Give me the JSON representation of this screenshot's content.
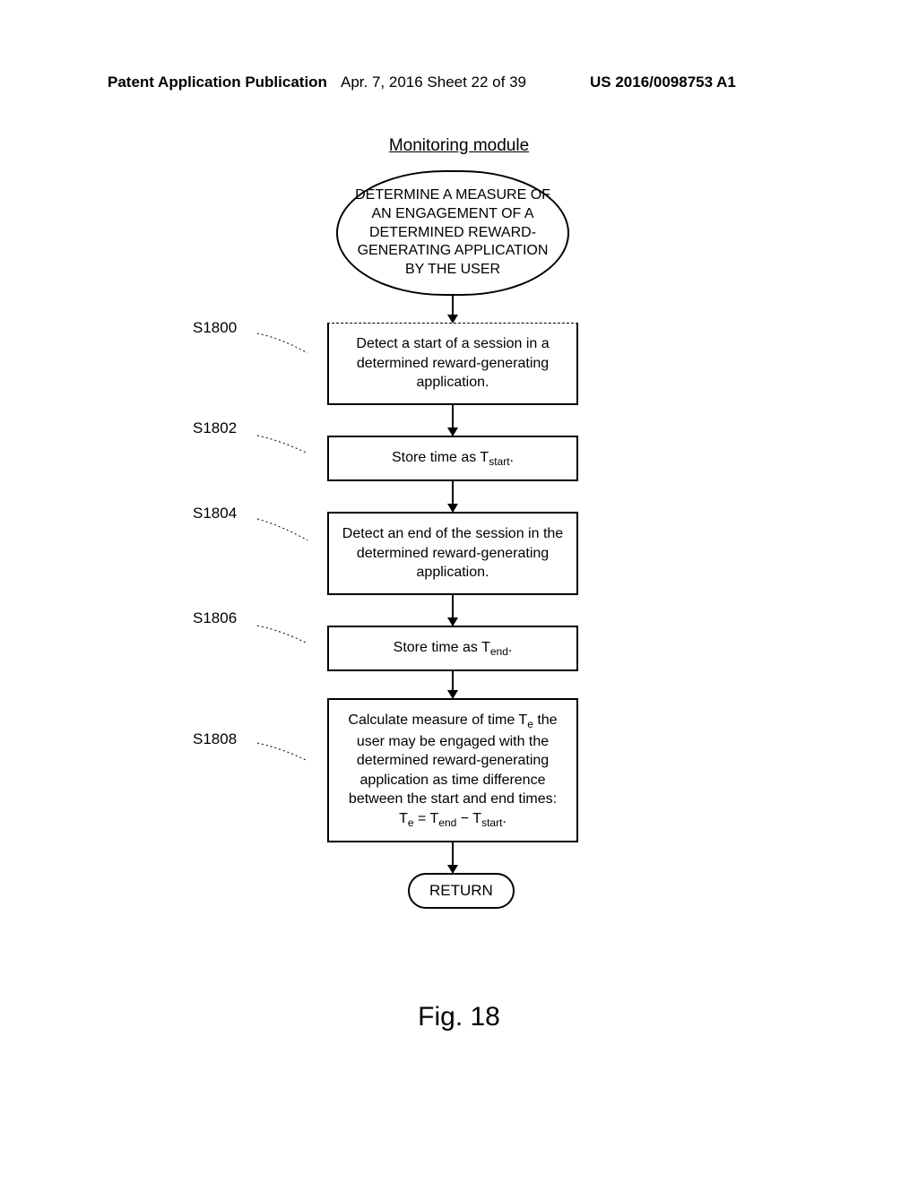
{
  "header": {
    "left": "Patent Application Publication",
    "mid": "Apr. 7, 2016  Sheet 22 of 39",
    "right": "US 2016/0098753 A1"
  },
  "section_title": "Monitoring module",
  "start": "DETERMINE A MEASURE OF AN ENGAGEMENT OF A DETERMINED REWARD-GENERATING APPLICATION BY THE USER",
  "steps": [
    {
      "label": "S1800",
      "text": "Detect a start of a session in a determined reward-generating application."
    },
    {
      "label": "S1802",
      "text_html": "Store time as T<sub>start</sub>."
    },
    {
      "label": "S1804",
      "text": "Detect an end of the session in the determined reward-generating application."
    },
    {
      "label": "S1806",
      "text_html": "Store time as T<sub>end</sub>."
    },
    {
      "label": "S1808",
      "text_html": "Calculate measure of time T<sub>e</sub> the user may be engaged with the determined reward-generating application as time difference between the start and end times:<br>T<sub>e</sub> = T<sub>end</sub> − T<sub>start</sub>."
    }
  ],
  "return": "RETURN",
  "figure": "Fig. 18"
}
